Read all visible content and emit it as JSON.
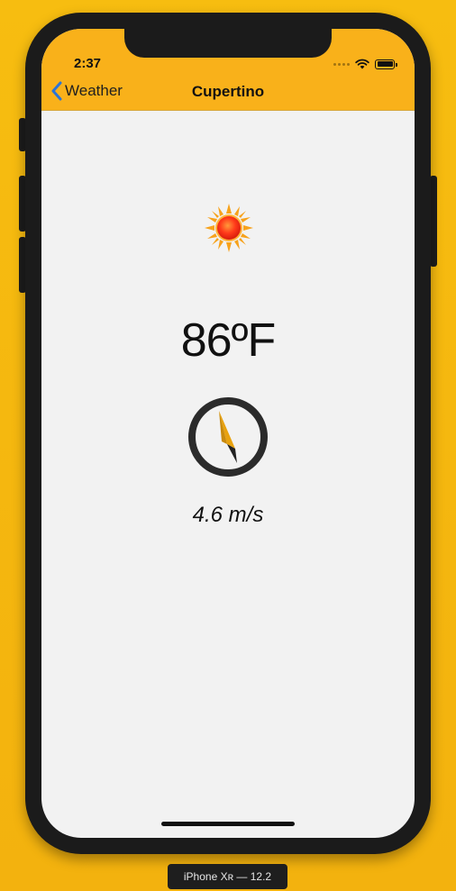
{
  "status_bar": {
    "time": "2:37"
  },
  "nav": {
    "back_label": "Weather",
    "title": "Cupertino"
  },
  "weather": {
    "icon": "sun-icon",
    "temperature": "86ºF",
    "wind_direction_icon": "compass-icon",
    "wind_speed": "4.6 m/s"
  },
  "device_label": "iPhone Xʀ — 12.2",
  "colors": {
    "background": "#f5b611",
    "nav_bar": "#f9b11a",
    "screen": "#f2f2f2",
    "back_chevron": "#2b74d6",
    "compass_needle": "#e8a20f"
  }
}
